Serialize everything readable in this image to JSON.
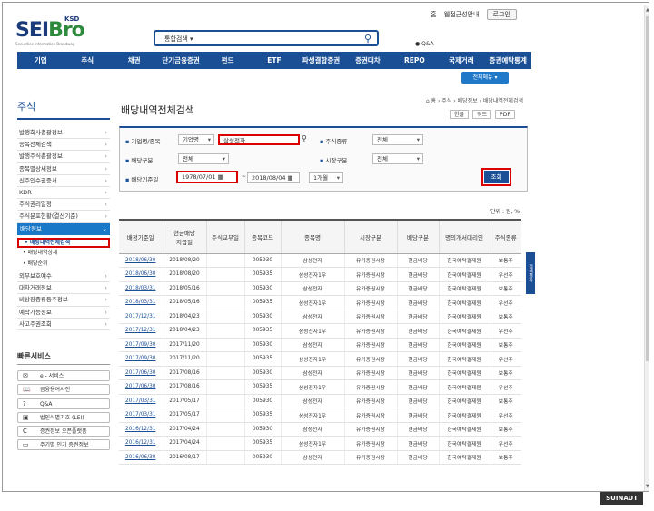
{
  "logo": {
    "brand_a": "SEI",
    "brand_b": "Bro",
    "ksd": "KSD",
    "ksd_sub": "증권정보포털",
    "tagline": "Securities Information Broadway"
  },
  "search": {
    "select_label": "통합검색"
  },
  "top_links": [
    "홈",
    "웹접근성안내",
    "로그인"
  ],
  "qa_label": "Q&A",
  "gnb": [
    "기업",
    "주식",
    "채권",
    "단기금융증권",
    "펀드",
    "ETF",
    "파생결합증권",
    "증권대차",
    "REPO",
    "국제거래",
    "증권예탁통계"
  ],
  "all_menu": "전체메뉴",
  "lnb": {
    "title": "주식",
    "items_top": [
      "발행회사총괄정보",
      "종목전체검색",
      "발행주식총괄정보",
      "종목별상세정보",
      "신주인수권증서",
      "KDR",
      "주식권리일정",
      "주식분포현황(결산기준)"
    ],
    "active": "배당정보",
    "subs": [
      "배당내역전체검색",
      "배당내역상세",
      "배당순위"
    ],
    "items_bottom": [
      "외부보호예수",
      "대차거래정보",
      "비상장증류등주정보",
      "예탁가능정보",
      "사고주권조회"
    ]
  },
  "quick": {
    "title": "빠른서비스",
    "items": [
      {
        "icon": "✉",
        "label": "e - 서비스"
      },
      {
        "icon": "📖",
        "label": "금융용어사전"
      },
      {
        "icon": "?",
        "label": "Q&A"
      },
      {
        "icon": "▣",
        "label": "법인식별기호 (LEI)"
      },
      {
        "icon": "C",
        "label": "증권정보 오픈플랫폼"
      },
      {
        "icon": "▭",
        "label": "주기별 인기 증권정보"
      }
    ]
  },
  "page": {
    "title": "배당내역전체검색",
    "breadcrumb": "⌂ 홈 › 주식 › 배당정보 › 배당내역전체검색",
    "tools": [
      "한글",
      "워드",
      "PDF"
    ]
  },
  "filter": {
    "label_company": "기업명/종목",
    "company_type": "기업명",
    "company_value": "삼성전자",
    "label_stock_type": "주식종류",
    "stock_type": "전체",
    "label_div_type": "배당구분",
    "div_type": "전체",
    "label_market": "시장구분",
    "market": "전체",
    "label_date": "배당기준일",
    "date_from": "1978/07/01",
    "date_to": "2018/08/04",
    "period": "1개월",
    "search_btn": "조회"
  },
  "unit": "단위 : 원, %",
  "side_tab": "검색결과",
  "table": {
    "headers": [
      "배정기준일",
      "현금배당\n지급일",
      "주식교부일",
      "종목코드",
      "종목명",
      "시장구분",
      "배당구분",
      "명의개서대리인",
      "주식종류"
    ],
    "rows": [
      [
        "2018/06/30",
        "2018/08/20",
        "",
        "005930",
        "삼성전자",
        "유가증권시장",
        "현금배당",
        "한국예탁결제원",
        "보통주"
      ],
      [
        "2018/06/30",
        "2018/08/20",
        "",
        "005935",
        "삼성전자1우",
        "유가증권시장",
        "현금배당",
        "한국예탁결제원",
        "우선주"
      ],
      [
        "2018/03/31",
        "2018/05/16",
        "",
        "005930",
        "삼성전자",
        "유가증권시장",
        "현금배당",
        "한국예탁결제원",
        "보통주"
      ],
      [
        "2018/03/31",
        "2018/05/16",
        "",
        "005935",
        "삼성전자1우",
        "유가증권시장",
        "현금배당",
        "한국예탁결제원",
        "우선주"
      ],
      [
        "2017/12/31",
        "2018/04/23",
        "",
        "005930",
        "삼성전자",
        "유가증권시장",
        "현금배당",
        "한국예탁결제원",
        "보통주"
      ],
      [
        "2017/12/31",
        "2018/04/23",
        "",
        "005935",
        "삼성전자1우",
        "유가증권시장",
        "현금배당",
        "한국예탁결제원",
        "우선주"
      ],
      [
        "2017/09/30",
        "2017/11/20",
        "",
        "005930",
        "삼성전자",
        "유가증권시장",
        "현금배당",
        "한국예탁결제원",
        "보통주"
      ],
      [
        "2017/09/30",
        "2017/11/20",
        "",
        "005935",
        "삼성전자1우",
        "유가증권시장",
        "현금배당",
        "한국예탁결제원",
        "우선주"
      ],
      [
        "2017/06/30",
        "2017/08/16",
        "",
        "005930",
        "삼성전자",
        "유가증권시장",
        "현금배당",
        "한국예탁결제원",
        "보통주"
      ],
      [
        "2017/06/30",
        "2017/08/16",
        "",
        "005935",
        "삼성전자1우",
        "유가증권시장",
        "현금배당",
        "한국예탁결제원",
        "우선주"
      ],
      [
        "2017/03/31",
        "2017/05/17",
        "",
        "005930",
        "삼성전자",
        "유가증권시장",
        "현금배당",
        "한국예탁결제원",
        "보통주"
      ],
      [
        "2017/03/31",
        "2017/05/17",
        "",
        "005935",
        "삼성전자1우",
        "유가증권시장",
        "현금배당",
        "한국예탁결제원",
        "우선주"
      ],
      [
        "2016/12/31",
        "2017/04/24",
        "",
        "005930",
        "삼성전자",
        "유가증권시장",
        "현금배당",
        "한국예탁결제원",
        "보통주"
      ],
      [
        "2016/12/31",
        "2017/04/24",
        "",
        "005935",
        "삼성전자1우",
        "유가증권시장",
        "현금배당",
        "한국예탁결제원",
        "우선주"
      ],
      [
        "2016/06/30",
        "2016/08/17",
        "",
        "005930",
        "삼성전자",
        "유가증권시장",
        "현금배당",
        "한국예탁결제원",
        "보통주"
      ]
    ]
  },
  "badge": "SUINAUT"
}
